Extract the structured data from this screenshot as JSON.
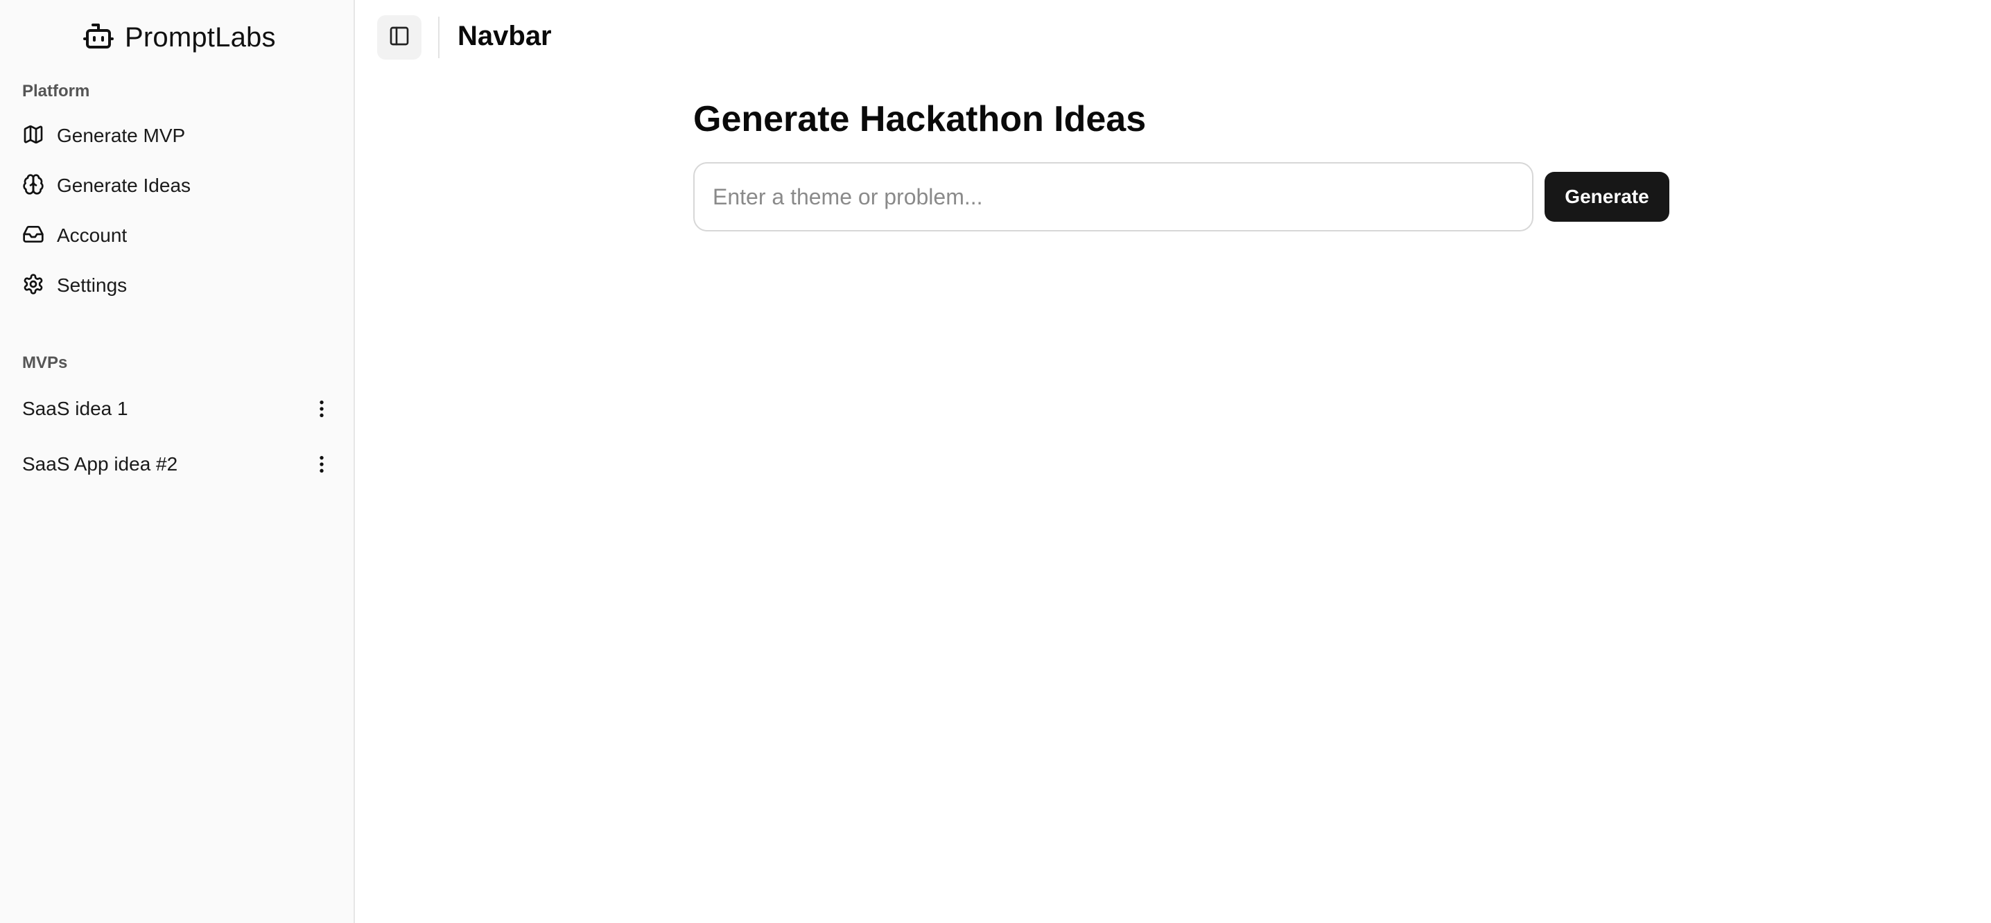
{
  "sidebar": {
    "brand": {
      "name": "PromptLabs",
      "icon": "bot-icon"
    },
    "platform": {
      "label": "Platform",
      "items": [
        {
          "label": "Generate MVP",
          "icon": "map-icon"
        },
        {
          "label": "Generate Ideas",
          "icon": "brain-icon"
        },
        {
          "label": "Account",
          "icon": "inbox-icon"
        },
        {
          "label": "Settings",
          "icon": "gear-icon"
        }
      ]
    },
    "mvps": {
      "label": "MVPs",
      "items": [
        {
          "label": "SaaS idea 1",
          "icon": "more-vertical-icon"
        },
        {
          "label": "SaaS App idea #2",
          "icon": "more-vertical-icon"
        }
      ]
    }
  },
  "topbar": {
    "title": "Navbar",
    "toggle_icon": "panel-left-icon"
  },
  "main": {
    "title": "Generate Hackathon Ideas",
    "input": {
      "value": "",
      "placeholder": "Enter a theme or problem..."
    },
    "generate_label": "Generate"
  },
  "colors": {
    "sidebar_bg": "#fafafa",
    "primary_button": "#171717",
    "border": "#d7d7d7"
  }
}
